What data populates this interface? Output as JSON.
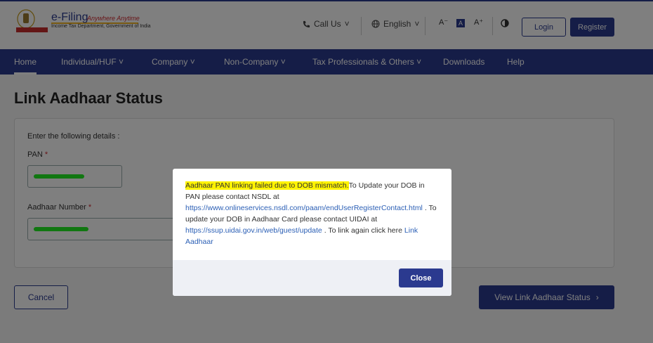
{
  "header": {
    "brand": "e-Filing",
    "tagline": "Anywhere Anytime",
    "department": "Income Tax Department, Government of India",
    "call_us": "Call Us",
    "language": "English",
    "font_decrease": "A⁻",
    "font_normal": "A",
    "font_increase": "A⁺",
    "contrast_icon": "contrast-icon",
    "login": "Login",
    "register": "Register"
  },
  "nav": {
    "items": [
      "Home",
      "Individual/HUF",
      "Company",
      "Non-Company",
      "Tax Professionals & Others",
      "Downloads",
      "Help"
    ],
    "dropdown_marker": "˅"
  },
  "page": {
    "title": "Link Aadhaar Status",
    "instructions": "Enter the following details :",
    "pan_label": "PAN",
    "aadhaar_label": "Aadhaar Number",
    "required_mark": "*",
    "cancel": "Cancel",
    "view_status": "View Link Aadhaar Status",
    "view_chevron": "›"
  },
  "modal": {
    "highlight": "Aadhaar PAN linking failed due to DOB mismatch.",
    "text1": "To Update your DOB in PAN please contact NSDL at",
    "link1": "https://www.onlineservices.nsdl.com/paam/endUserRegisterContact.html",
    "text2": " . To update your DOB in Aadhaar Card please contact UIDAI at",
    "link2": "https://ssup.uidai.gov.in/web/guest/update",
    "text3": " . To link again click here ",
    "link3": "Link Aadhaar",
    "close": "Close"
  },
  "colors": {
    "brand": "#2b3a8f",
    "highlight": "#fff300",
    "link": "#2b5fb5",
    "redaction": "#22ee22"
  }
}
